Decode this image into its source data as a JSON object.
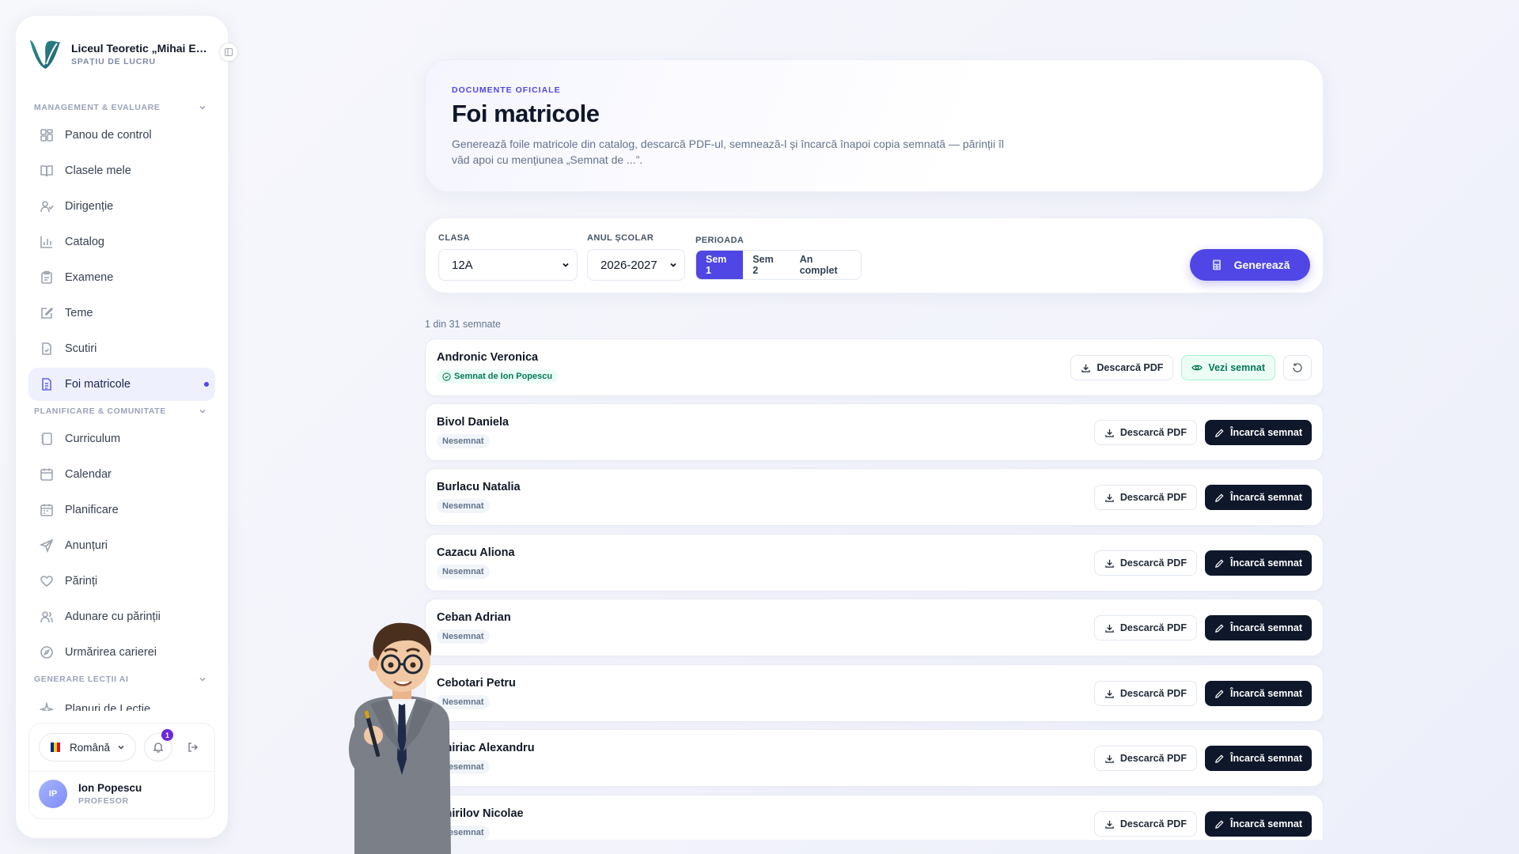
{
  "sidebar": {
    "school_name": "Liceul Teoretic „Mihai Eminescu”",
    "workspace_label": "SPAȚIU DE LUCRU",
    "sections": [
      {
        "title": "MANAGEMENT & EVALUARE",
        "items": [
          {
            "label": "Panou de control",
            "icon": "dashboard-icon"
          },
          {
            "label": "Clasele mele",
            "icon": "book-icon"
          },
          {
            "label": "Dirigenție",
            "icon": "users-icon"
          },
          {
            "label": "Catalog",
            "icon": "chart-icon"
          },
          {
            "label": "Examene",
            "icon": "clipboard-icon"
          },
          {
            "label": "Teme",
            "icon": "edit-icon"
          },
          {
            "label": "Scutiri",
            "icon": "file-check-icon"
          },
          {
            "label": "Foi matricole",
            "icon": "document-icon",
            "active": true
          }
        ]
      },
      {
        "title": "PLANIFICARE & COMUNITATE",
        "items": [
          {
            "label": "Curriculum",
            "icon": "notebook-icon"
          },
          {
            "label": "Calendar",
            "icon": "calendar-icon"
          },
          {
            "label": "Planificare",
            "icon": "calendar-grid-icon"
          },
          {
            "label": "Anunțuri",
            "icon": "send-icon"
          },
          {
            "label": "Părinți",
            "icon": "heart-icon"
          },
          {
            "label": "Adunare cu părinții",
            "icon": "people-icon"
          },
          {
            "label": "Urmărirea carierei",
            "icon": "compass-icon"
          }
        ]
      },
      {
        "title": "GENERARE LECȚII AI",
        "items": [
          {
            "label": "Planuri de Lecție",
            "icon": "sparkle-icon"
          }
        ]
      }
    ],
    "language": "Română",
    "notifications_count": "1",
    "user": {
      "initials": "IP",
      "name": "Ion Popescu",
      "role": "PROFESOR"
    }
  },
  "header": {
    "eyebrow": "DOCUMENTE OFICIALE",
    "title": "Foi matricole",
    "description": "Generează foile matricole din catalog, descarcă PDF-ul, semnează-l și încarcă înapoi copia semnată — părinții îl văd apoi cu mențiunea „Semnat de ...”."
  },
  "filters": {
    "class_label": "CLASA",
    "class_value": "12A",
    "year_label": "ANUL ȘCOLAR",
    "year_value": "2026-2027",
    "period_label": "PERIOADA",
    "periods": [
      "Sem 1",
      "Sem 2",
      "An complet"
    ],
    "active_period": "Sem 1",
    "generate_label": "Generează"
  },
  "summary": "1 din 31 semnate",
  "labels": {
    "download": "Descarcă PDF",
    "view_signed": "Vezi semnat",
    "upload_signed": "Încarcă semnat",
    "unsigned": "Nesemnat"
  },
  "students": [
    {
      "name": "Andronic Veronica",
      "status": "Semnat de Ion Popescu",
      "signed": true
    },
    {
      "name": "Bivol Daniela",
      "status": "Nesemnat",
      "signed": false
    },
    {
      "name": "Burlacu Natalia",
      "status": "Nesemnat",
      "signed": false
    },
    {
      "name": "Cazacu Aliona",
      "status": "Nesemnat",
      "signed": false
    },
    {
      "name": "Ceban Adrian",
      "status": "Nesemnat",
      "signed": false
    },
    {
      "name": "Cebotari Petru",
      "status": "Nesemnat",
      "signed": false
    },
    {
      "name": "Chiriac Alexandru",
      "status": "Nesemnat",
      "signed": false
    },
    {
      "name": "Chirilov Nicolae",
      "status": "Nesemnat",
      "signed": false
    }
  ],
  "colors": {
    "accent": "#4f46e5",
    "dark_button": "#0f172a",
    "signed_green": "#047857"
  }
}
